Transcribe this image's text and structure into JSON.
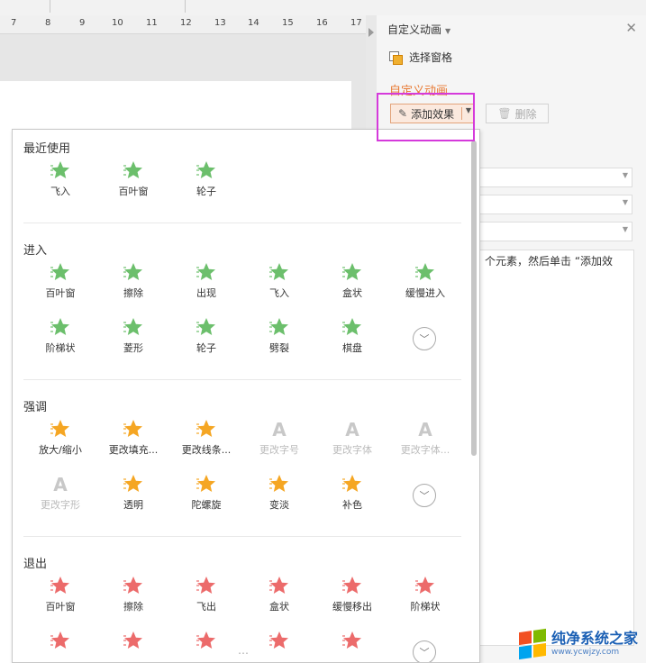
{
  "ruler": {
    "numbers": [
      "7",
      "8",
      "9",
      "10",
      "11",
      "12",
      "13",
      "14",
      "15",
      "16",
      "17"
    ]
  },
  "task_pane": {
    "title": "自定义动画",
    "selection_pane": "选择窗格",
    "section_title": "自定义动画",
    "add_effect_button": "添加效果",
    "delete_button": "删除",
    "hint": "个元素，然后单击 “添加效"
  },
  "effects_menu": {
    "sections": [
      {
        "title": "最近使用",
        "items": [
          {
            "label": "飞入",
            "icon": "fly-in-star-icon",
            "color": "green"
          },
          {
            "label": "百叶窗",
            "icon": "blinds-star-icon",
            "color": "green"
          },
          {
            "label": "轮子",
            "icon": "wheel-star-icon",
            "color": "green"
          }
        ]
      },
      {
        "title": "进入",
        "items": [
          {
            "label": "百叶窗",
            "icon": "blinds-star-icon",
            "color": "green"
          },
          {
            "label": "擦除",
            "icon": "wipe-star-icon",
            "color": "green"
          },
          {
            "label": "出现",
            "icon": "appear-star-icon",
            "color": "green"
          },
          {
            "label": "飞入",
            "icon": "fly-in-star-icon",
            "color": "green"
          },
          {
            "label": "盒状",
            "icon": "box-star-icon",
            "color": "green"
          },
          {
            "label": "缓慢进入",
            "icon": "crawl-in-star-icon",
            "color": "green"
          },
          {
            "label": "阶梯状",
            "icon": "stairs-star-icon",
            "color": "green"
          },
          {
            "label": "菱形",
            "icon": "diamond-star-icon",
            "color": "green"
          },
          {
            "label": "轮子",
            "icon": "wheel-star-icon",
            "color": "green"
          },
          {
            "label": "劈裂",
            "icon": "split-star-icon",
            "color": "green"
          },
          {
            "label": "棋盘",
            "icon": "checkerboard-star-icon",
            "color": "green"
          }
        ]
      },
      {
        "title": "强调",
        "items": [
          {
            "label": "放大/缩小",
            "icon": "grow-shrink-star-icon",
            "color": "orange"
          },
          {
            "label": "更改填充...",
            "icon": "change-fill-icon",
            "color": "orange"
          },
          {
            "label": "更改线条...",
            "icon": "change-line-icon",
            "color": "orange"
          },
          {
            "label": "更改字号",
            "icon": "font-size-icon",
            "color": "disabled"
          },
          {
            "label": "更改字体",
            "icon": "font-icon",
            "color": "disabled"
          },
          {
            "label": "更改字体...",
            "icon": "font-color-icon",
            "color": "disabled"
          },
          {
            "label": "更改字形",
            "icon": "font-style-icon",
            "color": "disabled"
          },
          {
            "label": "透明",
            "icon": "transparency-star-icon",
            "color": "orange"
          },
          {
            "label": "陀螺旋",
            "icon": "spin-star-icon",
            "color": "orange"
          },
          {
            "label": "变淡",
            "icon": "fade-star-icon",
            "color": "orange"
          },
          {
            "label": "补色",
            "icon": "complementary-color-star-icon",
            "color": "orange"
          }
        ]
      },
      {
        "title": "退出",
        "items": [
          {
            "label": "百叶窗",
            "icon": "blinds-star-icon",
            "color": "red"
          },
          {
            "label": "擦除",
            "icon": "wipe-star-icon",
            "color": "red"
          },
          {
            "label": "飞出",
            "icon": "fly-out-star-icon",
            "color": "red"
          },
          {
            "label": "盒状",
            "icon": "box-star-icon",
            "color": "red"
          },
          {
            "label": "缓慢移出",
            "icon": "crawl-out-star-icon",
            "color": "red"
          },
          {
            "label": "阶梯状",
            "icon": "stairs-star-icon",
            "color": "red"
          }
        ]
      }
    ]
  },
  "colors": {
    "enter_green": "#6cbf6c",
    "emphasis_orange": "#f5a623",
    "exit_red": "#ec6b6b",
    "highlight_box": "#d53adb",
    "section_orange": "#e87830"
  },
  "watermark": {
    "title": "纯净系统之家",
    "url": "www.ycwjzy.com"
  }
}
